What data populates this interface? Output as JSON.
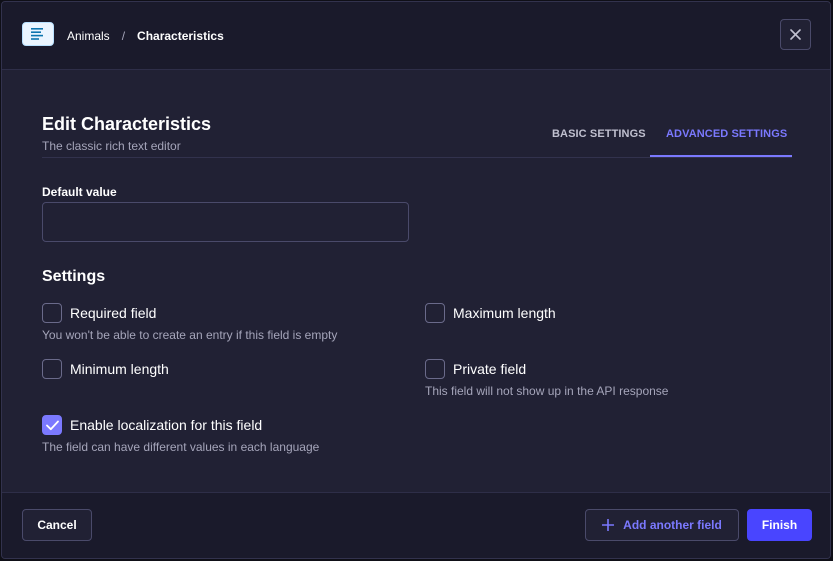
{
  "header": {
    "breadcrumb_parent": "Animals",
    "breadcrumb_separator": "/",
    "breadcrumb_current": "Characteristics",
    "type_icon": "rich-text-icon",
    "close_icon": "close-icon"
  },
  "form": {
    "title": "Edit Characteristics",
    "subtitle": "The classic rich text editor",
    "tabs": [
      {
        "label": "BASIC SETTINGS",
        "active": false
      },
      {
        "label": "ADVANCED SETTINGS",
        "active": true
      }
    ],
    "default_value": {
      "label": "Default value",
      "value": "",
      "placeholder": ""
    },
    "settings_title": "Settings",
    "options": [
      {
        "label": "Required field",
        "hint": "You won't be able to create an entry if this field is empty",
        "checked": false
      },
      {
        "label": "Maximum length",
        "hint": "",
        "checked": false
      },
      {
        "label": "Minimum length",
        "hint": "",
        "checked": false
      },
      {
        "label": "Private field",
        "hint": "This field will not show up in the API response",
        "checked": false
      },
      {
        "label": "Enable localization for this field",
        "hint": "The field can have different values in each language",
        "checked": true
      }
    ]
  },
  "footer": {
    "cancel_label": "Cancel",
    "add_label": "Add another field",
    "finish_label": "Finish"
  },
  "colors": {
    "accent": "#7b79ff",
    "primary_button": "#4945ff",
    "background": "#212134"
  }
}
